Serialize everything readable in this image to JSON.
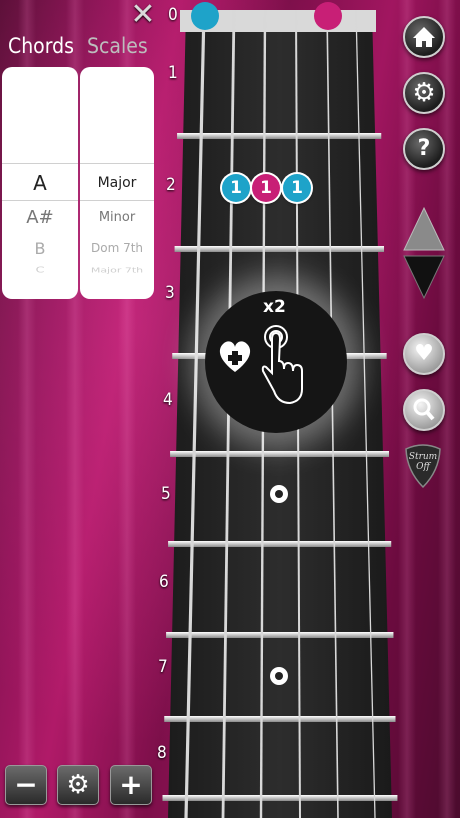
{
  "header": {
    "close_icon": "close-icon",
    "tabs": {
      "chords": "Chords",
      "scales": "Scales"
    }
  },
  "picker": {
    "roots": [
      {
        "label": "A",
        "state": "selected"
      },
      {
        "label": "A#",
        "state": "next"
      },
      {
        "label": "B",
        "state": "next2"
      },
      {
        "label": "C",
        "state": "next3"
      }
    ],
    "qualities": [
      {
        "label": "Major",
        "state": "selected"
      },
      {
        "label": "Minor",
        "state": "next"
      },
      {
        "label": "Dom 7th",
        "state": "next2"
      },
      {
        "label": "Major 7th",
        "state": "next3"
      }
    ]
  },
  "fretboard": {
    "fret_numbers": [
      "0",
      "1",
      "2",
      "3",
      "4",
      "5",
      "6",
      "7",
      "8"
    ],
    "open_dots": [
      {
        "string": 1,
        "color": "#1ea3c9"
      },
      {
        "string": 5,
        "color": "#c81f76"
      }
    ],
    "note_dots": [
      {
        "label": "1",
        "color": "#1ea3c9"
      },
      {
        "label": "1",
        "color": "#c81f76"
      },
      {
        "label": "1",
        "color": "#1ea3c9"
      }
    ]
  },
  "tutorial": {
    "tap_label": "x2",
    "icons": [
      "heart-plus-icon",
      "double-tap-hand-icon"
    ]
  },
  "sidebar_buttons": [
    "home-icon",
    "settings-icon",
    "help-icon",
    "up-arrow-icon",
    "down-arrow-icon",
    "heart-icon",
    "search-icon",
    "strum-off-pick-icon"
  ],
  "pick_text": "Strum\nOff",
  "bottom_buttons": {
    "minus": "−",
    "settings": "settings-icon",
    "plus": "+"
  },
  "colors": {
    "blue": "#1ea3c9",
    "pink": "#c81f76"
  }
}
